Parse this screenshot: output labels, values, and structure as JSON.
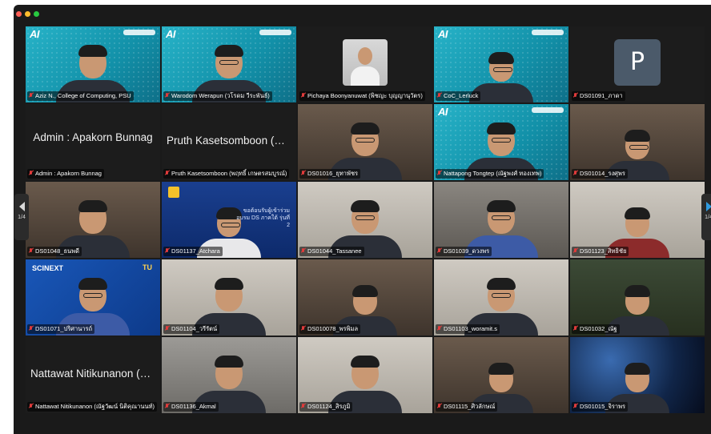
{
  "meeting": {
    "page_indicator": "1/4",
    "ai_logo_text": "AI",
    "tiles": [
      {
        "name": "Aziz N., College of Computing, PSU",
        "bg": "ai"
      },
      {
        "name": "Warodom Werapun (วโรดม วีระพันธ์)",
        "bg": "ai"
      },
      {
        "name": "Pichaya Boonyanuwat (พิชญะ บุญญานุวัตร)",
        "bg": "avatar-img"
      },
      {
        "name": "CoC_Lerluck",
        "bg": "ai"
      },
      {
        "name": "DS01091_ภาดา",
        "bg": "letter",
        "avatar_letter": "P"
      },
      {
        "name": "Admin : Apakorn Bunnag",
        "big_name": "Admin : Apakorn Bunnag",
        "bg": "blank"
      },
      {
        "name": "Pruth Kasetsomboon (พฤทธิ์ เกษตรสมบูรณ์)",
        "big_name": "Pruth Kasetsomboon (พฤ...",
        "bg": "blank"
      },
      {
        "name": "DS01016_ยุทาพัชร",
        "bg": "warm"
      },
      {
        "name": "Nattapong Tongtep (ณัฐพงศ์ ทองเทพ)",
        "bg": "ai"
      },
      {
        "name": "DS01014_รงศุพร",
        "bg": "warm"
      },
      {
        "name": "DS01048_ธนพดี",
        "bg": "warm"
      },
      {
        "name": "DS01137_Atchara",
        "bg": "slide"
      },
      {
        "name": "DS01044_Tassanee",
        "bg": "office"
      },
      {
        "name": "DS01039_ดวงพร",
        "bg": "room"
      },
      {
        "name": "DS01123_สิทธิชัย",
        "bg": "office"
      },
      {
        "name": "DS01071_ปริศานารถ์",
        "bg": "scinext"
      },
      {
        "name": "DS01104_วรีรัตน์",
        "bg": "office"
      },
      {
        "name": "DS010078_พรพิมล",
        "bg": "warm"
      },
      {
        "name": "DS01103_woramit.s",
        "bg": "office"
      },
      {
        "name": "DS01032_ณัฐ",
        "bg": "garden"
      },
      {
        "name": "Nattawat Nitikunanon (ณัฐวัฒน์ นิติคุณานนท์)",
        "big_name": "Nattawat Nitikunanon (ณัฐ...",
        "bg": "blank"
      },
      {
        "name": "DS01136_Akmal",
        "bg": "grey"
      },
      {
        "name": "DS01124_สิรภูมิ",
        "bg": "office"
      },
      {
        "name": "DS01115_ศิวลักษณ์",
        "bg": "warm"
      },
      {
        "name": "DS01015_จิราพร",
        "bg": "space"
      }
    ],
    "slide_text": "ขอต้อนรับผู้เข้าร่วมอบรม DS ภาคใต้ รุ่นที่ 2",
    "scinext_text": "SCINEXT",
    "tu_text": "TU",
    "colors": {
      "mic_muted": "#e03b3b",
      "accent_arrow": "#2f9be0"
    },
    "icons": {
      "mic": "microphone-muted-icon",
      "prev": "chevron-left-icon",
      "next": "chevron-right-icon"
    }
  }
}
